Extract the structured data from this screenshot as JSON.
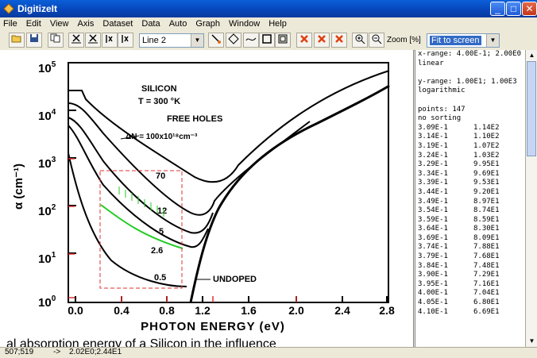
{
  "window": {
    "title": "DigitizeIt",
    "minimize": "_",
    "maximize": "□",
    "close": "✕"
  },
  "menu": [
    "File",
    "Edit",
    "View",
    "Axis",
    "Dataset",
    "Data",
    "Auto",
    "Graph",
    "Window",
    "Help"
  ],
  "toolbar": {
    "line_select": "Line 2",
    "zoom_label": "Zoom [%]",
    "zoom_select": "Fit to screen"
  },
  "graph": {
    "yticks": [
      "10",
      "10",
      "10",
      "10",
      "10",
      "10"
    ],
    "yexps": [
      "0",
      "1",
      "2",
      "3",
      "4",
      "5"
    ],
    "xticks": [
      "0.0",
      "0.4",
      "0.8",
      "1.2",
      "1.6",
      "2.0",
      "2.4",
      "2.8"
    ],
    "ylabel": "α (cm⁻¹)",
    "xlabel": "PHOTON ENERGY (eV)",
    "annot_silicon": "SILICON",
    "annot_temp": "T = 300 °K",
    "annot_free": "FREE HOLES",
    "annot_dn": "ΔN = 100x10¹⁸cm⁻³",
    "curve_labels": [
      "70",
      "12",
      "5",
      "2.6",
      "0.5"
    ],
    "undoped": "UNDOPED",
    "caption_fragment": "al absorption energy of a Silicon in the influence"
  },
  "panel": {
    "header": [
      "x-range: 4.00E-1; 2.00E0",
      "linear",
      "",
      "y-range: 1.00E1; 1.00E3",
      "logarithmic",
      "",
      "points: 147",
      "no sorting"
    ],
    "rows": [
      [
        "3.09E-1",
        "1.14E2"
      ],
      [
        "3.14E-1",
        "1.10E2"
      ],
      [
        "3.19E-1",
        "1.07E2"
      ],
      [
        "3.24E-1",
        "1.03E2"
      ],
      [
        "3.29E-1",
        "9.95E1"
      ],
      [
        "3.34E-1",
        "9.69E1"
      ],
      [
        "3.39E-1",
        "9.53E1"
      ],
      [
        "3.44E-1",
        "9.20E1"
      ],
      [
        "3.49E-1",
        "8.97E1"
      ],
      [
        "3.54E-1",
        "8.74E1"
      ],
      [
        "3.59E-1",
        "8.59E1"
      ],
      [
        "3.64E-1",
        "8.30E1"
      ],
      [
        "3.69E-1",
        "8.09E1"
      ],
      [
        "3.74E-1",
        "7.88E1"
      ],
      [
        "3.79E-1",
        "7.68E1"
      ],
      [
        "3.84E-1",
        "7.48E1"
      ],
      [
        "3.90E-1",
        "7.29E1"
      ],
      [
        "3.95E-1",
        "7.16E1"
      ],
      [
        "4.00E-1",
        "7.04E1"
      ],
      [
        "4.05E-1",
        "6.80E1"
      ],
      [
        "4.10E-1",
        "6.69E1"
      ]
    ]
  },
  "status": {
    "pixel": "507;519",
    "arrow": "->",
    "coord": "2.02E0;2.44E1"
  }
}
